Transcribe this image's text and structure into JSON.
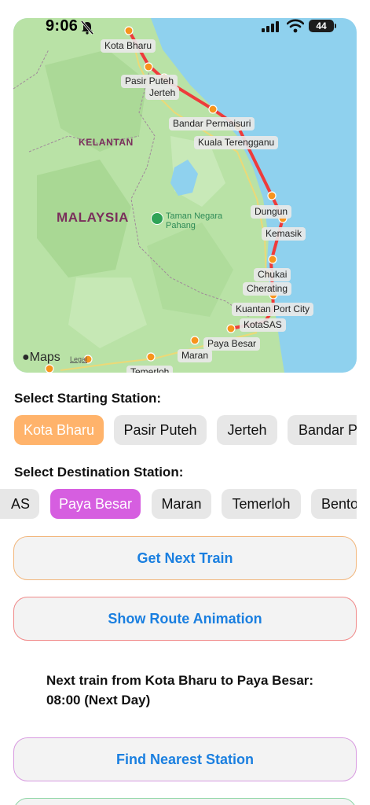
{
  "status_bar": {
    "time": "9:06",
    "battery": "44"
  },
  "map": {
    "brand": "Maps",
    "legal": "Legal",
    "regions": {
      "country": "MALAYSIA",
      "state": "KELANTAN"
    },
    "park": {
      "line1": "Taman Negara",
      "line2": "Pahang"
    },
    "stations": [
      "Kota Bharu",
      "Pasir Puteh",
      "Jerteh",
      "Bandar Permaisuri",
      "Kuala Terengganu",
      "Dungun",
      "Kemasik",
      "Chukai",
      "Cherating",
      "Kuantan Port City",
      "KotaSAS",
      "Paya Besar",
      "Maran",
      "Temerloh"
    ],
    "colors": {
      "route": "#ee3b3b",
      "station_dot": "#f7941d",
      "land": "#b6e0a4",
      "sea": "#8fd1ee"
    }
  },
  "start_section": {
    "title": "Select Starting Station:",
    "chips": [
      "Kota Bharu",
      "Pasir Puteh",
      "Jerteh",
      "Bandar P"
    ],
    "selected": "Kota Bharu"
  },
  "destination_section": {
    "title": "Select Destination Station:",
    "chips": [
      "AS",
      "Paya Besar",
      "Maran",
      "Temerloh",
      "Bento"
    ],
    "selected": "Paya Besar"
  },
  "buttons": {
    "next_train": "Get Next Train",
    "route_animation": "Show Route Animation",
    "nearest_station": "Find Nearest Station"
  },
  "result": {
    "line1": "Next train from Kota Bharu to Paya Besar:",
    "line2": "08:00 (Next Day)"
  }
}
